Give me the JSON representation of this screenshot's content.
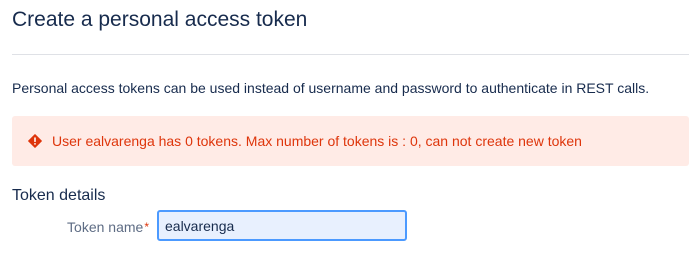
{
  "page": {
    "title": "Create a personal access token",
    "description": "Personal access tokens can be used instead of username and password to authenticate in REST calls."
  },
  "error": {
    "icon": "error-icon",
    "message": "User ealvarenga has 0 tokens. Max number of tokens is : 0, can not create new token",
    "color": "#de350b",
    "background": "#ffebe6"
  },
  "token_details": {
    "heading": "Token details",
    "name_label": "Token name",
    "required_marker": "*",
    "name_value": "ealvarenga"
  }
}
